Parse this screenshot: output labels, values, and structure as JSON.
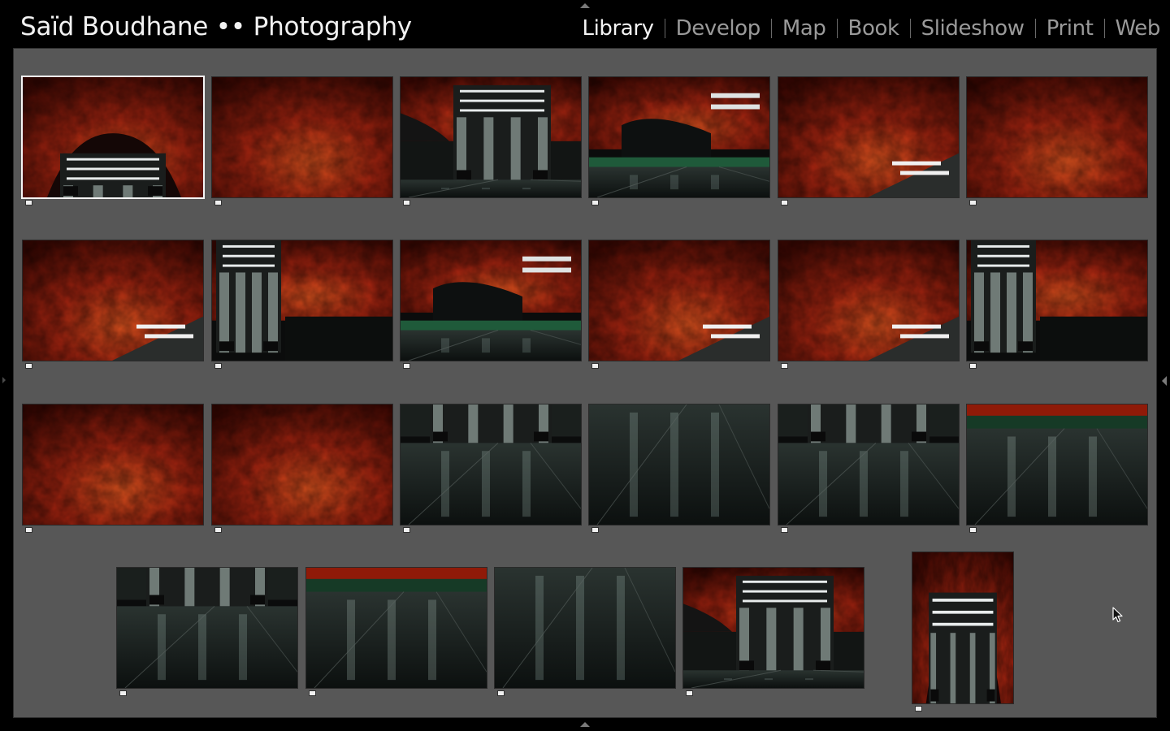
{
  "identity": {
    "title": "Saïd Boudhane •• Photography"
  },
  "modules": [
    {
      "label": "Library",
      "active": true
    },
    {
      "label": "Develop",
      "active": false
    },
    {
      "label": "Map",
      "active": false
    },
    {
      "label": "Book",
      "active": false
    },
    {
      "label": "Slideshow",
      "active": false
    },
    {
      "label": "Print",
      "active": false
    },
    {
      "label": "Web",
      "active": false
    }
  ],
  "filmstrip": {
    "photos": [
      {
        "scene": "escalator-cave",
        "selected": true
      },
      {
        "scene": "red-ceiling",
        "selected": false
      },
      {
        "scene": "escalator-wide",
        "selected": false
      },
      {
        "scene": "platform-cave",
        "selected": false
      },
      {
        "scene": "cave-edge",
        "selected": false
      },
      {
        "scene": "red-ceiling",
        "selected": false
      },
      {
        "scene": "cave-edge",
        "selected": false
      },
      {
        "scene": "escalator-side",
        "selected": false
      },
      {
        "scene": "platform-cave",
        "selected": false
      },
      {
        "scene": "cave-edge",
        "selected": false
      },
      {
        "scene": "cave-edge",
        "selected": false
      },
      {
        "scene": "escalator-side",
        "selected": false
      },
      {
        "scene": "red-ceiling",
        "selected": false
      },
      {
        "scene": "red-ceiling",
        "selected": false
      },
      {
        "scene": "floor-escalator",
        "selected": false
      },
      {
        "scene": "floor",
        "selected": false
      },
      {
        "scene": "floor-escalator",
        "selected": false
      },
      {
        "scene": "floor-green",
        "selected": false
      },
      {
        "scene": "floor-escalator",
        "selected": false
      },
      {
        "scene": "floor-green",
        "selected": false
      },
      {
        "scene": "floor",
        "selected": false
      },
      {
        "scene": "escalator-wide",
        "selected": false
      },
      {
        "scene": "escalator-portrait",
        "selected": false
      }
    ]
  },
  "colors": {
    "background": "#575757",
    "topbar": "#000000",
    "active_module": "#f4f4f4",
    "inactive_module": "#9a9a9a",
    "selection_border": "#f4f4f4",
    "cave_red": "#8f1a08",
    "cave_bright": "#e0531e"
  },
  "icons": {
    "top_panel_toggle": "triangle-up-icon",
    "bottom_panel_toggle": "triangle-up-icon",
    "right_panel_toggle": "triangle-left-icon",
    "left_panel_toggle": "triangle-right-icon",
    "pointer": "mouse-cursor-icon"
  }
}
